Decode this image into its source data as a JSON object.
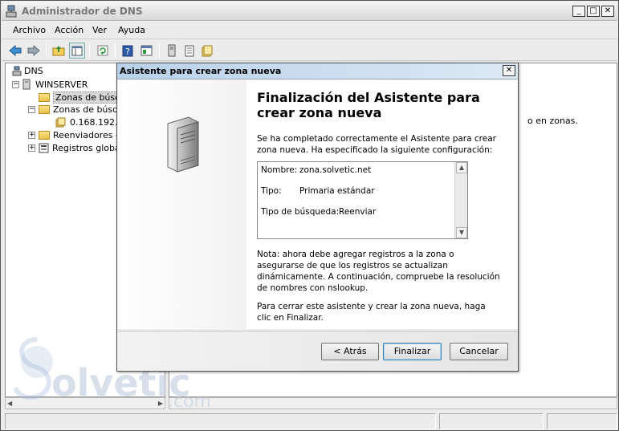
{
  "window": {
    "title": "Administrador de DNS",
    "min": "_",
    "max": "□",
    "close": "✕"
  },
  "menu": [
    "Archivo",
    "Acción",
    "Ver",
    "Ayuda"
  ],
  "tree": {
    "root": "DNS",
    "server": "WINSERVER",
    "items": [
      "Zonas de búsq",
      "Zonas de búsq",
      "0.168.192.i",
      "Reenviadores c",
      "Registros globa"
    ]
  },
  "content": {
    "partial_text": "o en zonas."
  },
  "dialog": {
    "title": "Asistente para crear zona nueva",
    "close": "✕",
    "heading": "Finalización del Asistente para crear zona nueva",
    "intro": "Se ha completado correctamente el Asistente para crear zona nueva. Ha especificado la siguiente configuración:",
    "summary": {
      "name_label": "Nombre:",
      "name_value": "zona.solvetic.net",
      "type_label": "Tipo:",
      "type_value": "Primaria estándar",
      "lookup_label": "Tipo de búsqueda:",
      "lookup_value": "Reenviar"
    },
    "note": "Nota: ahora debe agregar registros a la zona o asegurarse de que los registros se actualizan dinámicamente. A continuación, compruebe la resolución de nombres con nslookup.",
    "finish_text": "Para cerrar este asistente y crear la zona nueva, haga clic en Finalizar.",
    "buttons": {
      "back": "< Atrás",
      "finish": "Finalizar",
      "cancel": "Cancelar"
    }
  },
  "watermark": {
    "brand": "olvetic",
    "suffix": ".com"
  }
}
